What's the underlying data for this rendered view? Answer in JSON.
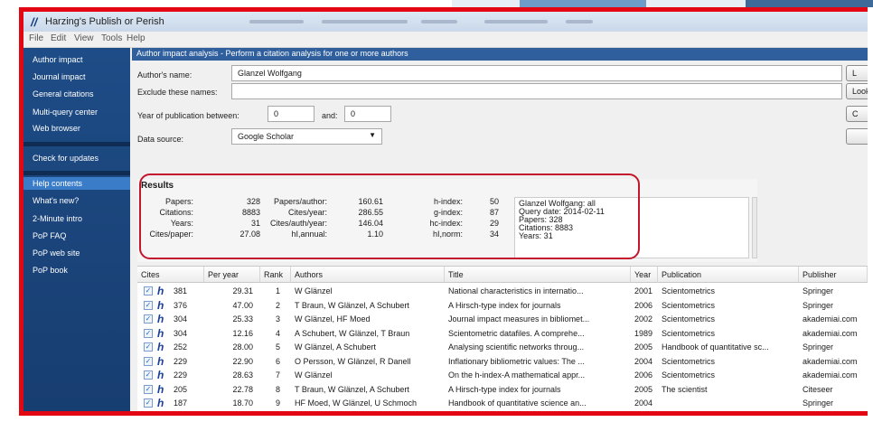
{
  "window": {
    "title": "Harzing's Publish or Perish",
    "menu": [
      "File",
      "Edit",
      "View",
      "Tools",
      "Help"
    ]
  },
  "sidebar": {
    "items": [
      {
        "label": "Author impact",
        "selected": false
      },
      {
        "label": "Journal impact",
        "selected": false
      },
      {
        "label": "General citations",
        "selected": false
      },
      {
        "label": "Multi-query center",
        "selected": false
      },
      {
        "label": "Web browser",
        "selected": false
      },
      {
        "label": "Check for updates",
        "selected": false
      },
      {
        "label": "Help contents",
        "selected": true
      },
      {
        "label": "What's new?",
        "selected": false
      },
      {
        "label": "2-Minute intro",
        "selected": false
      },
      {
        "label": "PoP FAQ",
        "selected": false
      },
      {
        "label": "PoP web site",
        "selected": false
      },
      {
        "label": "PoP book",
        "selected": false
      }
    ]
  },
  "header": {
    "text": "Author impact analysis - Perform a citation analysis for one or more authors"
  },
  "form": {
    "author_label": "Author's name:",
    "author_value": "Glanzel Wolfgang",
    "exclude_label": "Exclude these names:",
    "exclude_value": "",
    "year_label": "Year of publication between:",
    "year_from": "0",
    "and_label": "and:",
    "year_to": "0",
    "source_label": "Data source:",
    "source_value": "Google Scholar"
  },
  "side_buttons": [
    "L",
    "Look",
    "C",
    ""
  ],
  "results": {
    "heading": "Results",
    "metrics": [
      {
        "label": "Papers:",
        "value": "328"
      },
      {
        "label": "Citations:",
        "value": "8883"
      },
      {
        "label": "Years:",
        "value": "31"
      },
      {
        "label": "Cites/paper:",
        "value": "27.08"
      },
      {
        "label": "Papers/author:",
        "value": "160.61"
      },
      {
        "label": "Cites/year:",
        "value": "286.55"
      },
      {
        "label": "Cites/auth/year:",
        "value": "146.04"
      },
      {
        "label": "hI,annual:",
        "value": "1.10"
      },
      {
        "label": "h-index:",
        "value": "50"
      },
      {
        "label": "g-index:",
        "value": "87"
      },
      {
        "label": "hc-index:",
        "value": "29"
      },
      {
        "label": "hI,norm:",
        "value": "34"
      }
    ],
    "summary": [
      "Glanzel Wolfgang: all",
      "Query date: 2014-02-11",
      "Papers: 328",
      "Citations: 8883",
      "Years: 31"
    ]
  },
  "table": {
    "columns": [
      "Cites",
      "Per year",
      "Rank",
      "Authors",
      "Title",
      "Year",
      "Publication",
      "Publisher"
    ],
    "rows": [
      {
        "cites": "381",
        "per_year": "29.31",
        "rank": "1",
        "authors": "W Glänzel",
        "title": "National characteristics in internatio...",
        "year": "2001",
        "publication": "Scientometrics",
        "publisher": "Springer"
      },
      {
        "cites": "376",
        "per_year": "47.00",
        "rank": "2",
        "authors": "T Braun, W Glänzel, A Schubert",
        "title": "A Hirsch-type index for journals",
        "year": "2006",
        "publication": "Scientometrics",
        "publisher": "Springer"
      },
      {
        "cites": "304",
        "per_year": "25.33",
        "rank": "3",
        "authors": "W Glänzel, HF Moed",
        "title": "Journal impact measures in bibliomet...",
        "year": "2002",
        "publication": "Scientometrics",
        "publisher": "akademiai.com"
      },
      {
        "cites": "304",
        "per_year": "12.16",
        "rank": "4",
        "authors": "A Schubert, W Glänzel, T Braun",
        "title": "Scientometric datafiles. A comprehe...",
        "year": "1989",
        "publication": "Scientometrics",
        "publisher": "akademiai.com"
      },
      {
        "cites": "252",
        "per_year": "28.00",
        "rank": "5",
        "authors": "W Glänzel, A Schubert",
        "title": "Analysing scientific networks throug...",
        "year": "2005",
        "publication": "Handbook of quantitative sc...",
        "publisher": "Springer"
      },
      {
        "cites": "229",
        "per_year": "22.90",
        "rank": "6",
        "authors": "O Persson, W Glänzel, R Danell",
        "title": "Inflationary bibliometric values: The ...",
        "year": "2004",
        "publication": "Scientometrics",
        "publisher": "akademiai.com"
      },
      {
        "cites": "229",
        "per_year": "28.63",
        "rank": "7",
        "authors": "W Glänzel",
        "title": "On the h-index-A mathematical appr...",
        "year": "2006",
        "publication": "Scientometrics",
        "publisher": "akademiai.com"
      },
      {
        "cites": "205",
        "per_year": "22.78",
        "rank": "8",
        "authors": "T Braun, W Glänzel, A Schubert",
        "title": "A Hirsch-type index for journals",
        "year": "2005",
        "publication": "The scientist",
        "publisher": "Citeseer"
      },
      {
        "cites": "187",
        "per_year": "18.70",
        "rank": "9",
        "authors": "HF Moed, W Glänzel, U Schmoch",
        "title": "Handbook of quantitative science an...",
        "year": "2004",
        "publication": "",
        "publisher": "Springer"
      }
    ]
  },
  "colors": {
    "frame": "#e30613",
    "highlight": "#c3162c",
    "sidebar": "#1e4c86",
    "sidebar_selected": "#3a7cc8"
  }
}
